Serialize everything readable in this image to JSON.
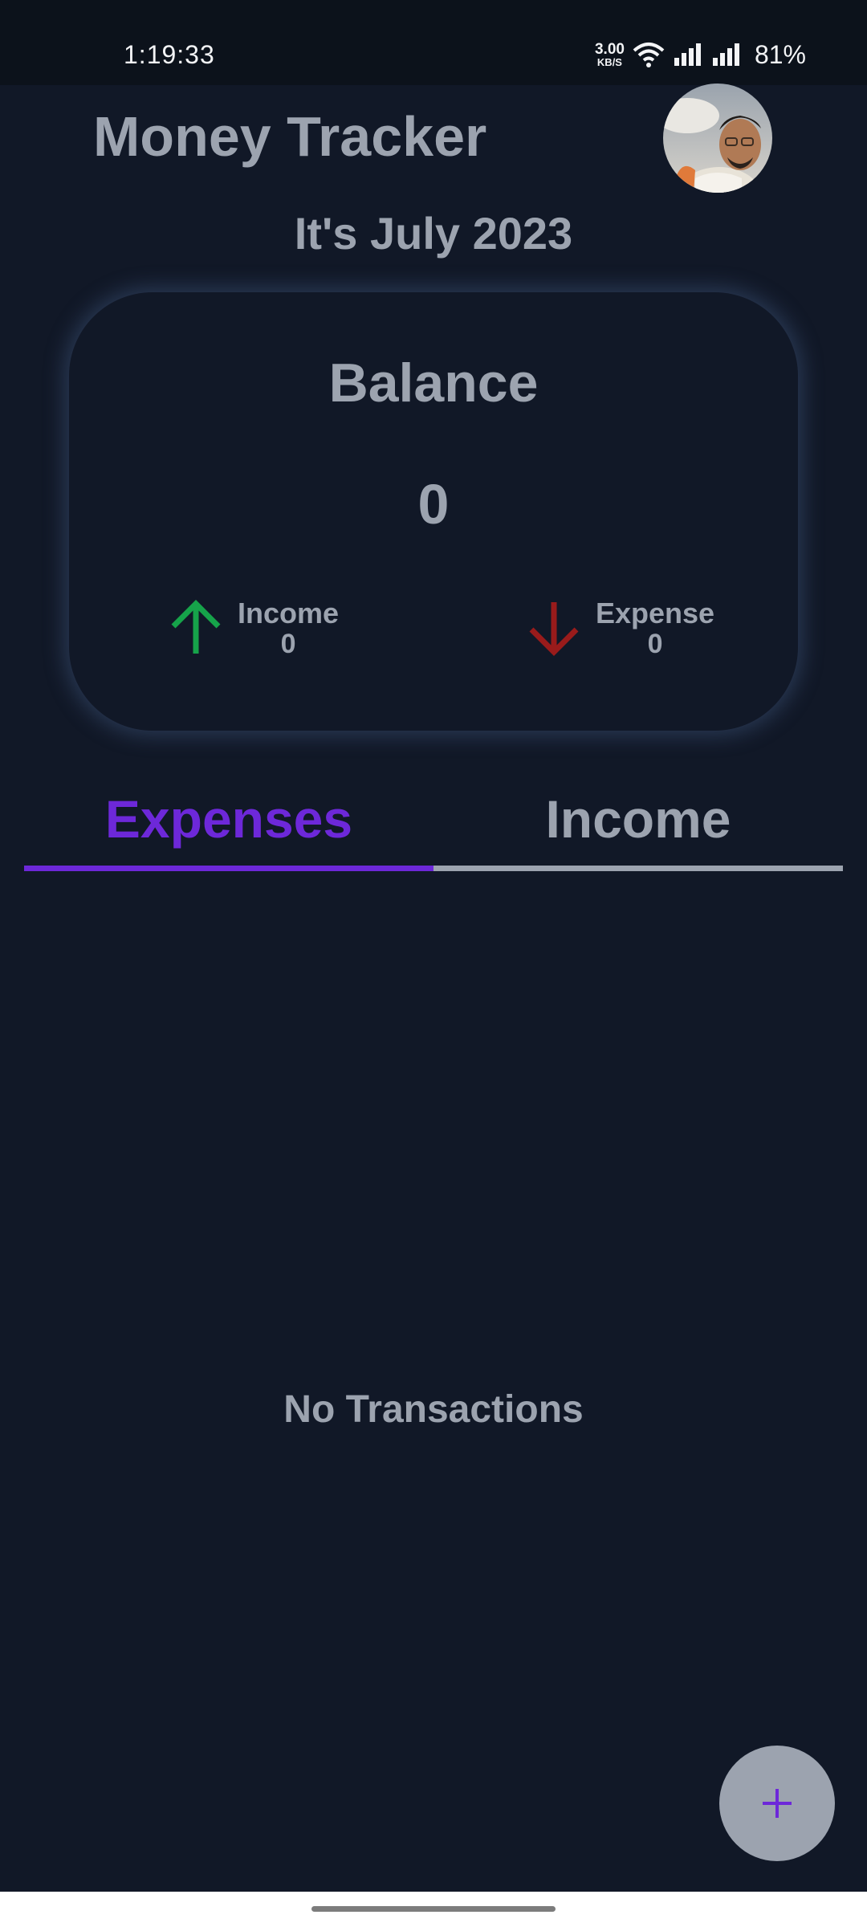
{
  "status_bar": {
    "time": "1:19:33",
    "net_speed_value": "3.00",
    "net_speed_unit": "KB/S",
    "battery": "81%",
    "icons": [
      "wifi-icon",
      "signal-icon",
      "signal-icon"
    ]
  },
  "header": {
    "title": "Money Tracker",
    "month_label": "It's July 2023"
  },
  "balance_card": {
    "label": "Balance",
    "value": "0",
    "income_label": "Income",
    "income_value": "0",
    "expense_label": "Expense",
    "expense_value": "0"
  },
  "tabs": [
    {
      "label": "Expenses",
      "active": true
    },
    {
      "label": "Income",
      "active": false
    }
  ],
  "empty_state": "No Transactions",
  "fab": {
    "icon": "plus-icon",
    "label": "+"
  },
  "colors": {
    "background": "#111827",
    "accent": "#6d28d9",
    "text": "#9ca3af",
    "income_arrow": "#16a34a",
    "expense_arrow": "#991b1b"
  }
}
